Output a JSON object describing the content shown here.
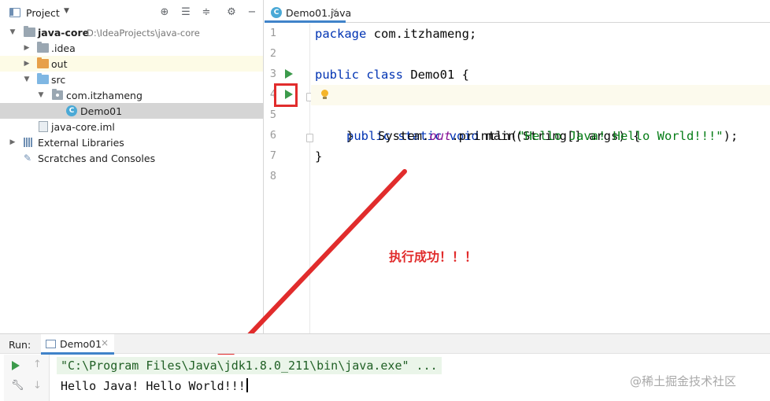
{
  "project_panel": {
    "title": "Project",
    "tree": [
      {
        "label": "java-core",
        "path": "D:\\IdeaProjects\\java-core"
      },
      {
        "label": ".idea"
      },
      {
        "label": "out"
      },
      {
        "label": "src"
      },
      {
        "label": "com.itzhameng"
      },
      {
        "label": "Demo01"
      },
      {
        "label": "java-core.iml"
      },
      {
        "label": "External Libraries"
      },
      {
        "label": "Scratches and Consoles"
      }
    ]
  },
  "editor": {
    "tab_label": "Demo01.java",
    "line_numbers": [
      "1",
      "2",
      "3",
      "4",
      "5",
      "6",
      "7",
      "8"
    ],
    "code": {
      "l1_kw": "package",
      "l1_rest": " com.itzhameng;",
      "l3_kw": "public class",
      "l3_rest": " Demo01 {",
      "l4_kw": "public static void",
      "l4_rest": " main(String[] args) {",
      "l5_a": "System.",
      "l5_field": "out",
      "l5_b": ".println(",
      "l5_str": "\"Hello Java! Hello World!!!\"",
      "l5_c": ");",
      "l6": "}",
      "l7": "}"
    }
  },
  "annotation": "执行成功！！！",
  "run_panel": {
    "title": "Run:",
    "tab_label": "Demo01",
    "command": "\"C:\\Program Files\\Java\\jdk1.8.0_211\\bin\\java.exe\" ...",
    "output": "Hello Java! Hello World!!!"
  },
  "watermark": "@稀土掘金技术社区",
  "colors": {
    "annotation_red": "#e12c2c",
    "run_green": "#3c9a4b",
    "keyword_blue": "#0033b3",
    "string_green": "#067d17"
  },
  "icons": [
    "project-view-icon",
    "locate-icon",
    "expand-all-icon",
    "collapse-all-icon",
    "gear-icon",
    "hide-icon",
    "folder-icon",
    "package-icon",
    "class-icon",
    "run-icon",
    "bulb-icon",
    "wrench-icon"
  ]
}
